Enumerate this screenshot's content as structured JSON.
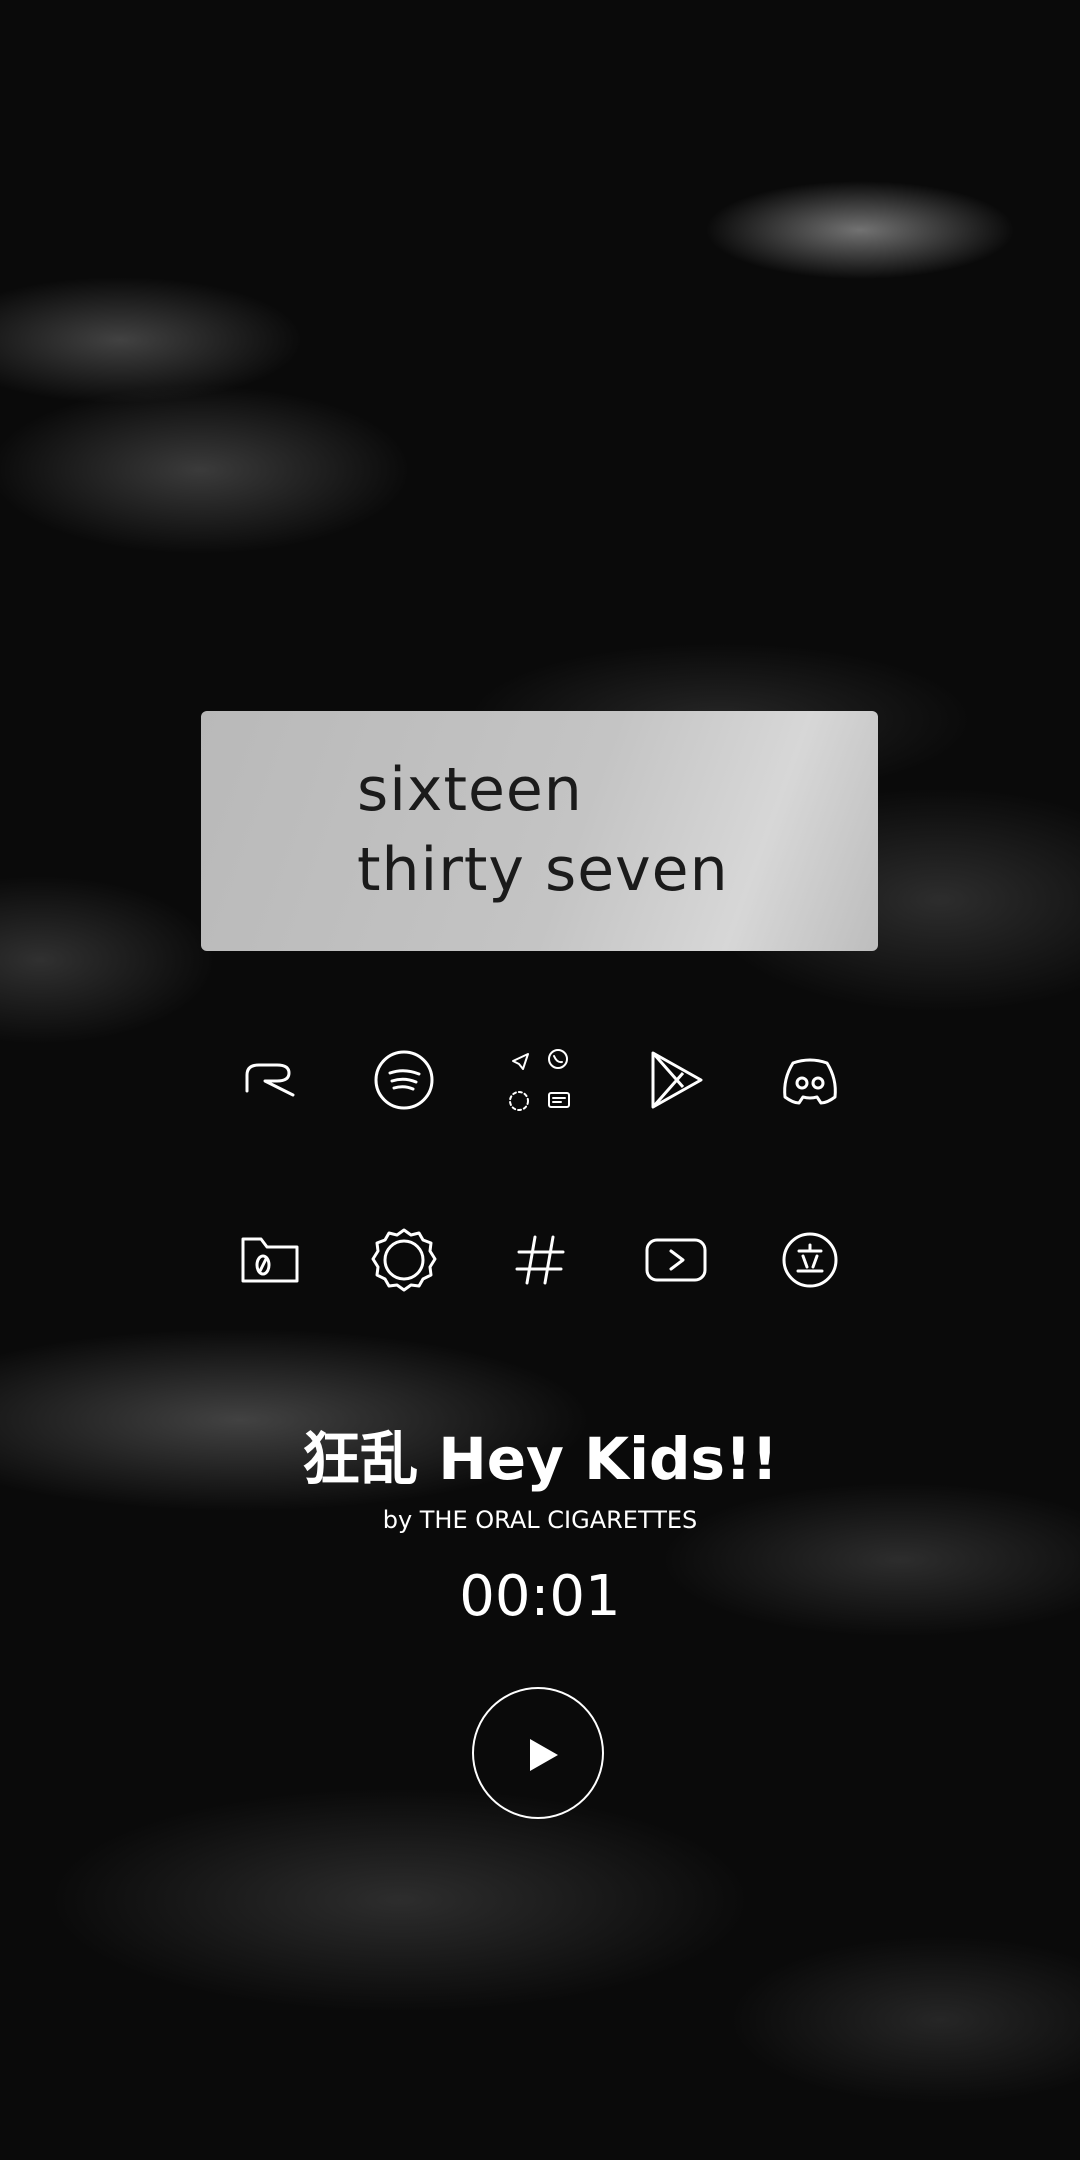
{
  "clock": {
    "hour_text": "sixteen",
    "minute_text": "thirty seven"
  },
  "dock": {
    "row1": [
      {
        "icon": "r-letter-icon"
      },
      {
        "icon": "spotify-icon"
      },
      {
        "icon": "messaging-folder-icon"
      },
      {
        "icon": "play-store-icon"
      },
      {
        "icon": "discord-icon"
      }
    ],
    "row2": [
      {
        "icon": "files-icon"
      },
      {
        "icon": "settings-gear-icon"
      },
      {
        "icon": "hashtag-icon"
      },
      {
        "icon": "youtube-icon"
      },
      {
        "icon": "translate-icon"
      }
    ]
  },
  "music": {
    "title": "狂乱 Hey Kids!!",
    "artist": "by THE ORAL CIGARETTES",
    "time": "00:01",
    "play_icon": "play-icon"
  },
  "colors": {
    "card": "#c4c4c4",
    "clock_text": "#1b1b1b",
    "foreground": "#ffffff"
  }
}
